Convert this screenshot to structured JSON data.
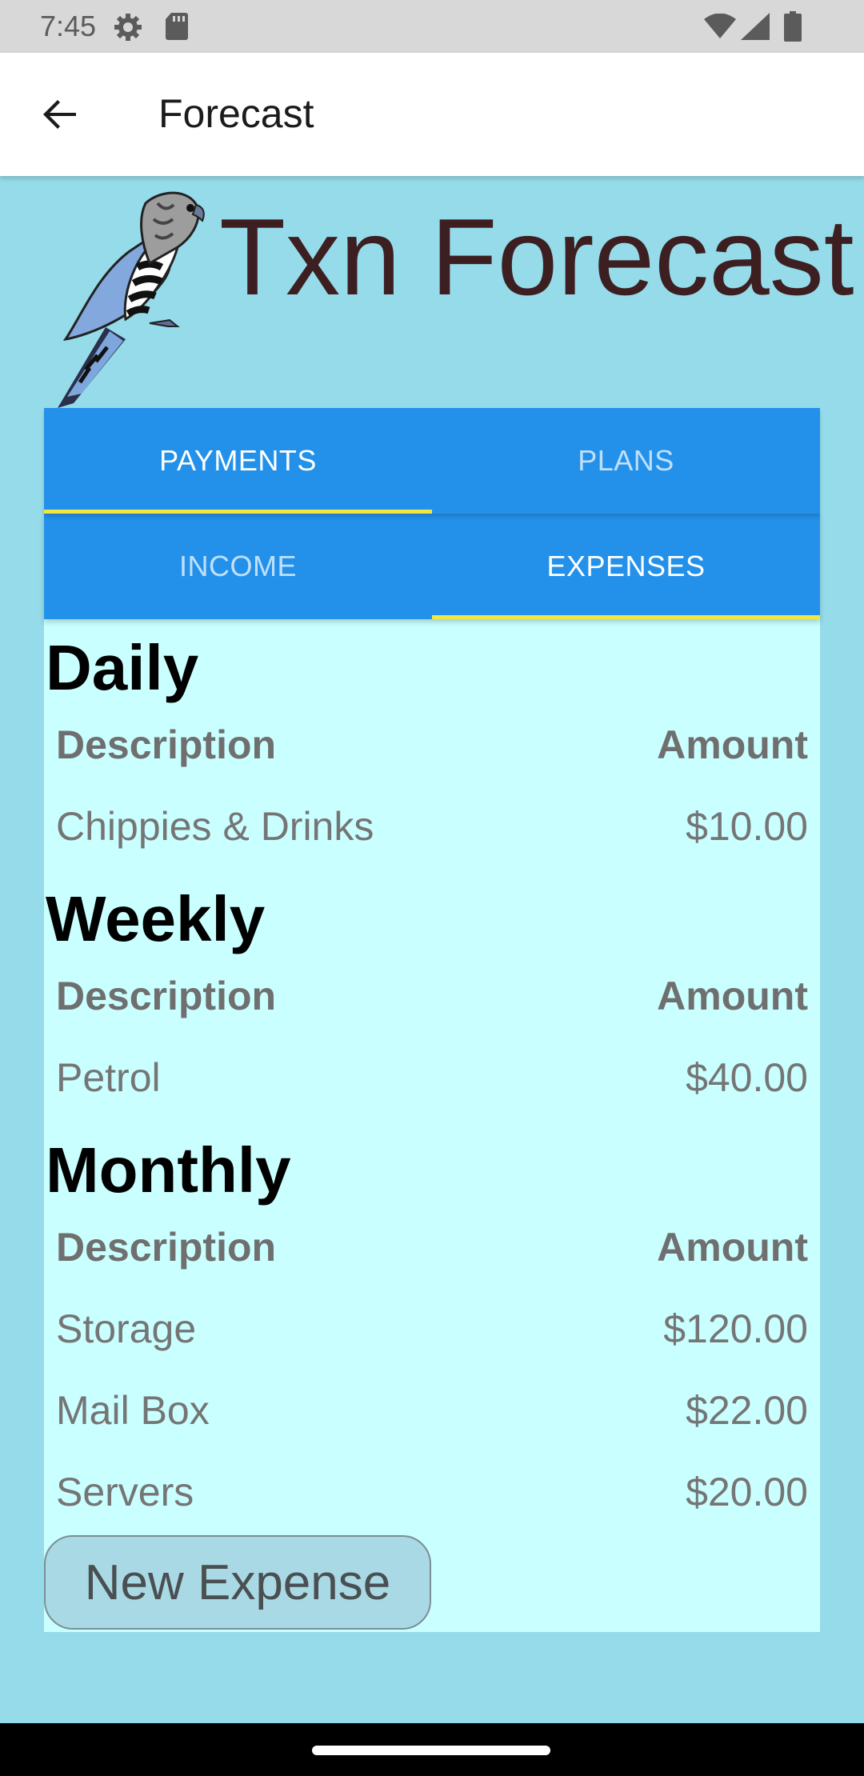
{
  "status_bar": {
    "time": "7:45",
    "icons": [
      "gear-icon",
      "sd-card-icon",
      "wifi-icon",
      "signal-icon",
      "battery-icon"
    ]
  },
  "app_bar": {
    "title": "Forecast",
    "back_icon": "arrow-left-icon"
  },
  "hero": {
    "title": "Txn Forecast",
    "logo": "parrot-logo"
  },
  "tabs_primary": [
    {
      "label": "PAYMENTS",
      "active": true
    },
    {
      "label": "PLANS",
      "active": false
    }
  ],
  "tabs_secondary": [
    {
      "label": "INCOME",
      "active": false
    },
    {
      "label": "EXPENSES",
      "active": true
    }
  ],
  "sections": [
    {
      "heading": "Daily",
      "columns": [
        "Description",
        "Amount"
      ],
      "rows": [
        {
          "description": "Chippies & Drinks",
          "amount": "$10.00"
        }
      ]
    },
    {
      "heading": "Weekly",
      "columns": [
        "Description",
        "Amount"
      ],
      "rows": [
        {
          "description": "Petrol",
          "amount": "$40.00"
        }
      ]
    },
    {
      "heading": "Monthly",
      "columns": [
        "Description",
        "Amount"
      ],
      "rows": [
        {
          "description": "Storage",
          "amount": "$120.00"
        },
        {
          "description": "Mail Box",
          "amount": "$22.00"
        },
        {
          "description": "Servers",
          "amount": "$20.00"
        }
      ]
    }
  ],
  "new_expense_button": "New Expense",
  "colors": {
    "page_background": "#95dbe9",
    "card_background": "#caffff",
    "tab_background": "#2391ea",
    "tab_indicator": "#f1e743",
    "hero_title": "#3d1f22"
  }
}
